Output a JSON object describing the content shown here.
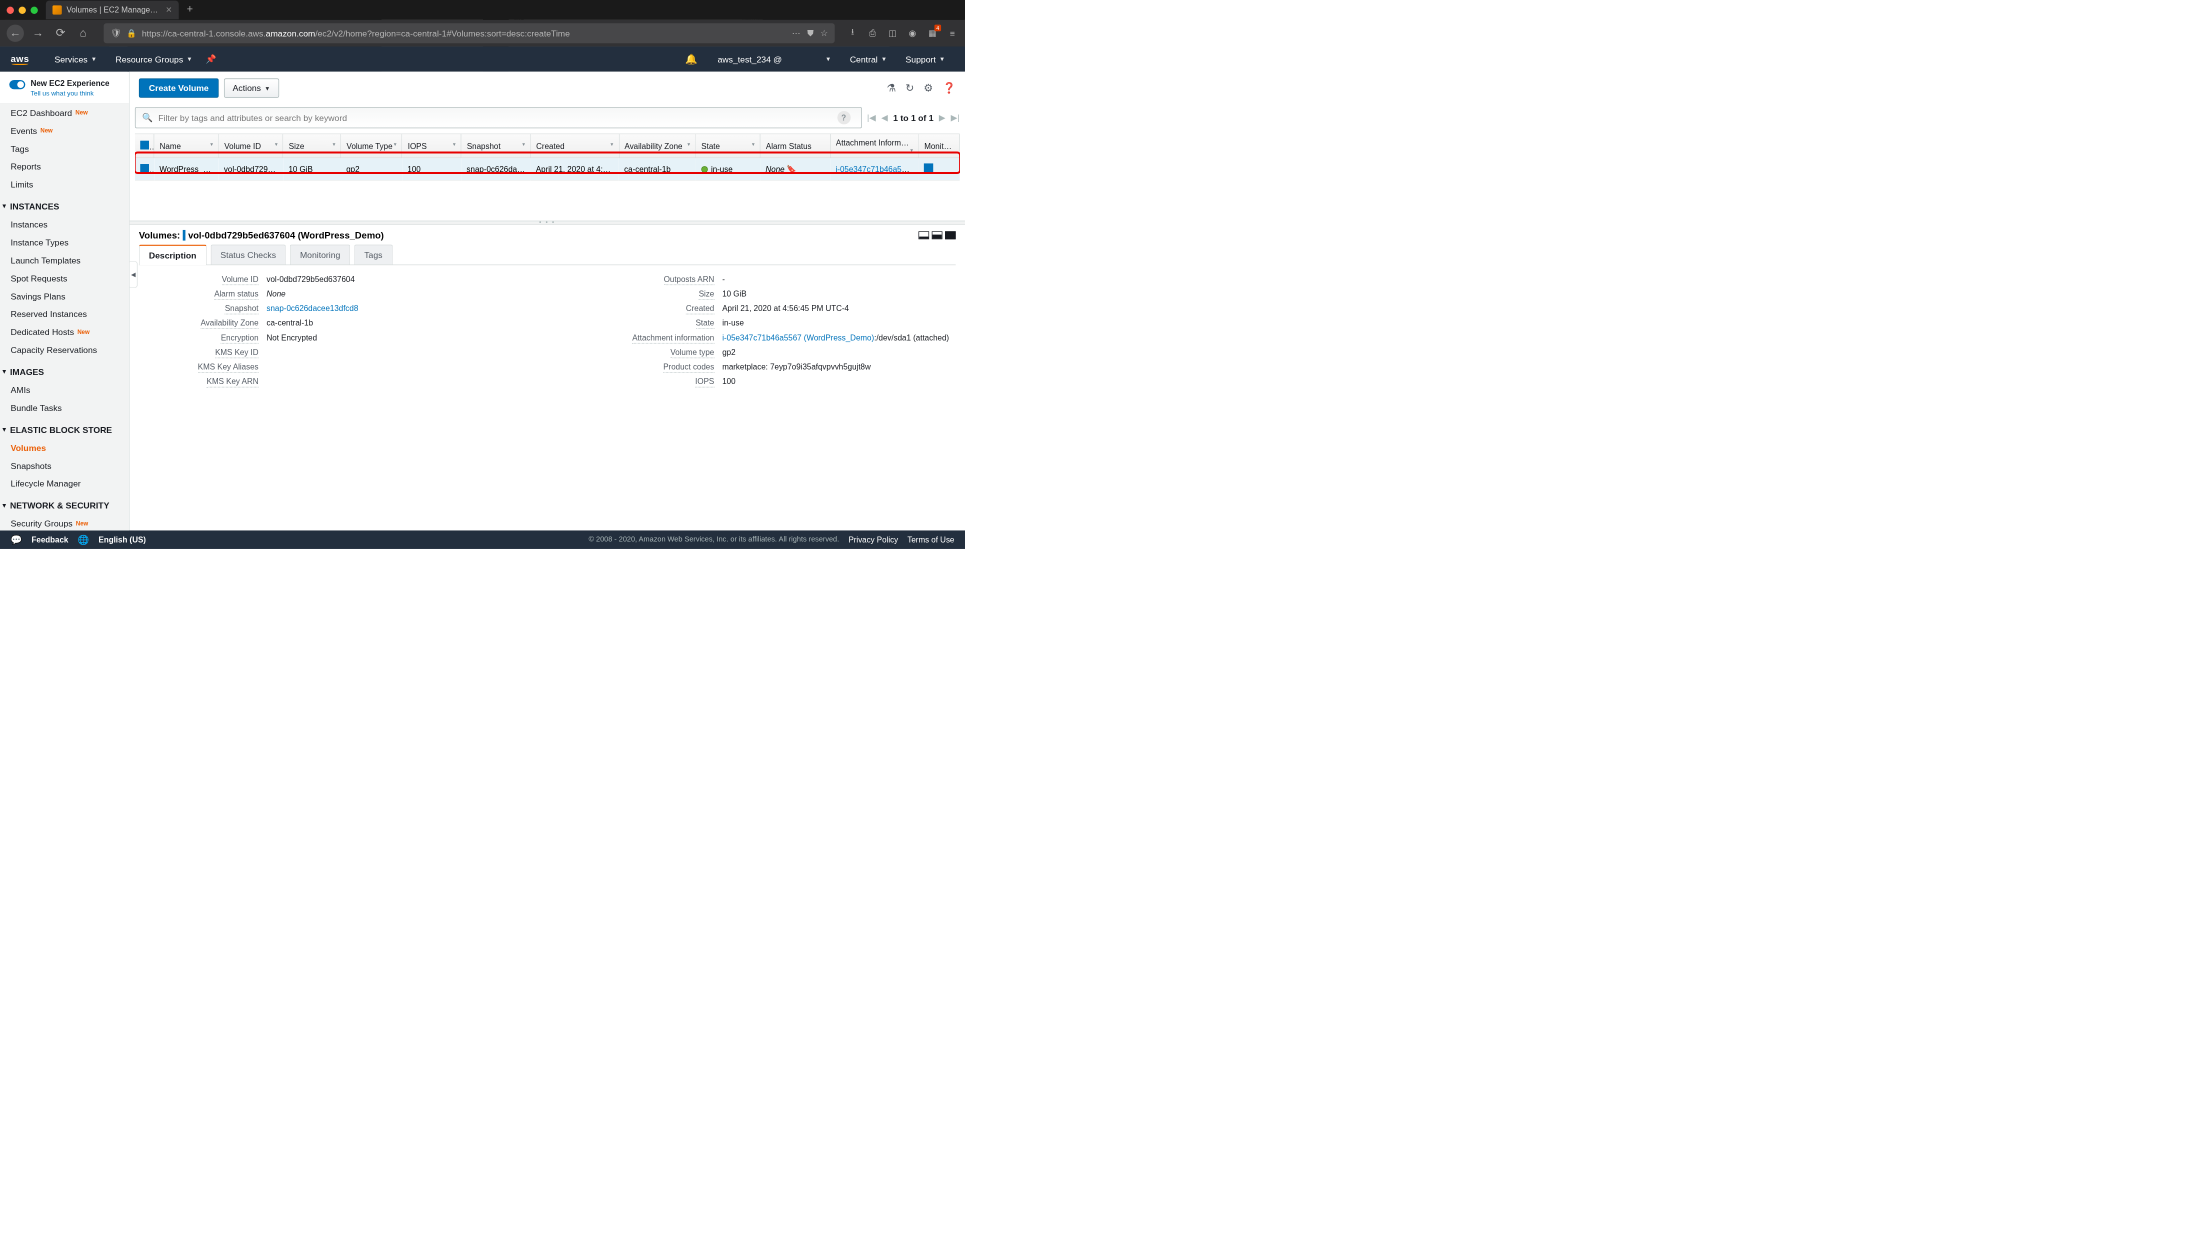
{
  "browser": {
    "tab_title": "Volumes | EC2 Management Co",
    "url_prefix": "https://ca-central-1.console.aws.",
    "url_domain": "amazon.com",
    "url_suffix": "/ec2/v2/home?region=ca-central-1#Volumes:sort=desc:createTime",
    "badge_count": "4"
  },
  "aws_nav": {
    "logo": "aws",
    "services": "Services",
    "resource_groups": "Resource Groups",
    "account": "aws_test_234 @",
    "region": "Central",
    "support": "Support"
  },
  "sidebar_top": {
    "title": "New EC2 Experience",
    "subtitle": "Tell us what you think"
  },
  "sidebar": [
    {
      "label": "EC2 Dashboard",
      "new": true
    },
    {
      "label": "Events",
      "new": true
    },
    {
      "label": "Tags"
    },
    {
      "label": "Reports"
    },
    {
      "label": "Limits"
    },
    {
      "label": "INSTANCES",
      "section": true
    },
    {
      "label": "Instances"
    },
    {
      "label": "Instance Types"
    },
    {
      "label": "Launch Templates"
    },
    {
      "label": "Spot Requests"
    },
    {
      "label": "Savings Plans"
    },
    {
      "label": "Reserved Instances"
    },
    {
      "label": "Dedicated Hosts",
      "new": true
    },
    {
      "label": "Capacity Reservations"
    },
    {
      "label": "IMAGES",
      "section": true
    },
    {
      "label": "AMIs"
    },
    {
      "label": "Bundle Tasks"
    },
    {
      "label": "ELASTIC BLOCK STORE",
      "section": true
    },
    {
      "label": "Volumes",
      "active": true
    },
    {
      "label": "Snapshots"
    },
    {
      "label": "Lifecycle Manager"
    },
    {
      "label": "NETWORK & SECURITY",
      "section": true
    },
    {
      "label": "Security Groups",
      "new": true
    }
  ],
  "action_bar": {
    "create_volume": "Create Volume",
    "actions": "Actions"
  },
  "filter": {
    "placeholder": "Filter by tags and attributes or search by keyword",
    "pager": "1 to 1 of 1"
  },
  "columns": [
    "Name",
    "Volume ID",
    "Size",
    "Volume Type",
    "IOPS",
    "Snapshot",
    "Created",
    "Availability Zone",
    "State",
    "Alarm Status",
    "Attachment Information",
    "Monitoring"
  ],
  "row": {
    "name": "WordPress_…",
    "volume_id": "vol-0dbd729…",
    "size": "10 GiB",
    "volume_type": "gp2",
    "iops": "100",
    "snapshot": "snap-0c626da…",
    "created": "April 21, 2020 at 4:5…",
    "az": "ca-central-1b",
    "state": "in-use",
    "alarm_status": "None",
    "attachment": "i-05e347c71b46a556…"
  },
  "detail_header": {
    "label": "Volumes:",
    "selection": "vol-0dbd729b5ed637604 (WordPress_Demo)"
  },
  "tabs": {
    "description": "Description",
    "status_checks": "Status Checks",
    "monitoring": "Monitoring",
    "tags": "Tags"
  },
  "detail_left": {
    "volume_id_lbl": "Volume ID",
    "volume_id": "vol-0dbd729b5ed637604",
    "alarm_status_lbl": "Alarm status",
    "alarm_status": "None",
    "snapshot_lbl": "Snapshot",
    "snapshot": "snap-0c626dacee13dfcd8",
    "az_lbl": "Availability Zone",
    "az": "ca-central-1b",
    "encryption_lbl": "Encryption",
    "encryption": "Not Encrypted",
    "kms_key_id_lbl": "KMS Key ID",
    "kms_key_id": "",
    "kms_aliases_lbl": "KMS Key Aliases",
    "kms_aliases": "",
    "kms_arn_lbl": "KMS Key ARN",
    "kms_arn": ""
  },
  "detail_right": {
    "outposts_arn_lbl": "Outposts ARN",
    "outposts_arn": "-",
    "size_lbl": "Size",
    "size": "10 GiB",
    "created_lbl": "Created",
    "created": "April 21, 2020 at 4:56:45 PM UTC-4",
    "state_lbl": "State",
    "state": "in-use",
    "attachment_lbl": "Attachment information",
    "attachment_link": "i-05e347c71b46a5567 (WordPress_Demo)",
    "attachment_suffix": ":/dev/sda1 (attached)",
    "volume_type_lbl": "Volume type",
    "volume_type": "gp2",
    "product_codes_lbl": "Product codes",
    "product_codes": "marketplace: 7eyp7o9i35afqvpvvh5gujt8w",
    "iops_lbl": "IOPS",
    "iops": "100"
  },
  "footer": {
    "feedback": "Feedback",
    "language": "English (US)",
    "copyright": "© 2008 - 2020, Amazon Web Services, Inc. or its affiliates. All rights reserved.",
    "privacy": "Privacy Policy",
    "terms": "Terms of Use"
  }
}
